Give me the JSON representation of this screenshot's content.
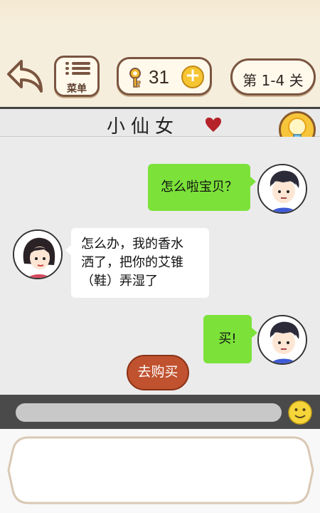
{
  "topbar": {
    "menu_label": "菜单",
    "coins": "31",
    "level": "第 1-4 关"
  },
  "chat": {
    "title": "小仙女",
    "hint_label": "提示",
    "messages": [
      {
        "side": "right",
        "text": "怎么啦宝贝？"
      },
      {
        "side": "left",
        "lines": [
          "怎么办，我的香水",
          "洒了，把你的艾锥",
          "（鞋）弄湿了"
        ]
      },
      {
        "side": "right",
        "text": "买!"
      }
    ],
    "shop_button": "去购买"
  },
  "input": {
    "value": ""
  },
  "colors": {
    "bubble_green": "#7ce23a",
    "accent_brown": "#7a5540",
    "coin_yellow": "#f6c531",
    "shop_red": "#c0522f"
  },
  "icons": [
    "back-arrow-icon",
    "menu-icon",
    "key-icon",
    "plus-icon",
    "heart-icon",
    "lightbulb-icon",
    "smiley-icon"
  ]
}
